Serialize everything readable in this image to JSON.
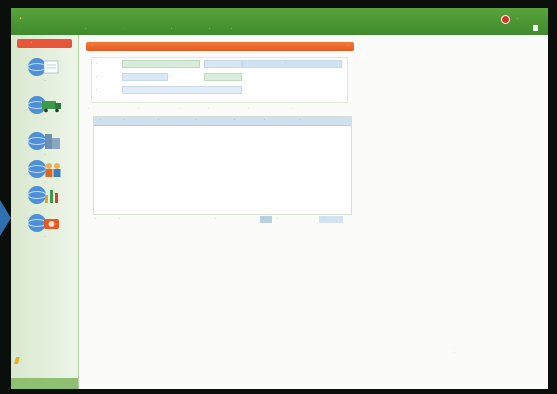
{
  "colors": {
    "brand_green": "#4a9a34",
    "accent_orange": "#e75a22",
    "grid_header": "#cfe0ee"
  },
  "topbar": {
    "logo_title": "·",
    "logo_subtitle": "·",
    "menu": [
      "·",
      "·",
      "·",
      "·",
      "·"
    ],
    "user_text": "·",
    "help_label": "·"
  },
  "sidebar": {
    "header": "·",
    "items": [
      {
        "label": "·",
        "icon": "globe-document-icon"
      },
      {
        "label": "·",
        "icon": "globe-truck-icon"
      },
      {
        "label": "·",
        "icon": "globe-building-icon"
      },
      {
        "label": "·",
        "icon": "globe-people-icon"
      },
      {
        "label": "·",
        "icon": "globe-chart-icon"
      },
      {
        "label": "·",
        "icon": "globe-tools-icon"
      }
    ],
    "footer_label": "·",
    "bottom_text": "·"
  },
  "panel": {
    "title": "·",
    "right_text": "·"
  },
  "form": {
    "row1_label": "·",
    "row1_button": "·",
    "row2_label_a": "·",
    "row2_label_b": "·",
    "row3_label": "·"
  },
  "tabs": [
    "·",
    "·",
    "·",
    "·",
    "·",
    "·"
  ],
  "grid": {
    "columns": [
      "·",
      "·",
      "·",
      "·",
      "·",
      "·",
      "·"
    ]
  },
  "grid_footer": {
    "left_a": "·",
    "left_b": "·",
    "center": "·",
    "page_label": "·",
    "right": "·",
    "go_label": "·"
  },
  "footnote": {
    "line1": "·",
    "line2": "·"
  }
}
